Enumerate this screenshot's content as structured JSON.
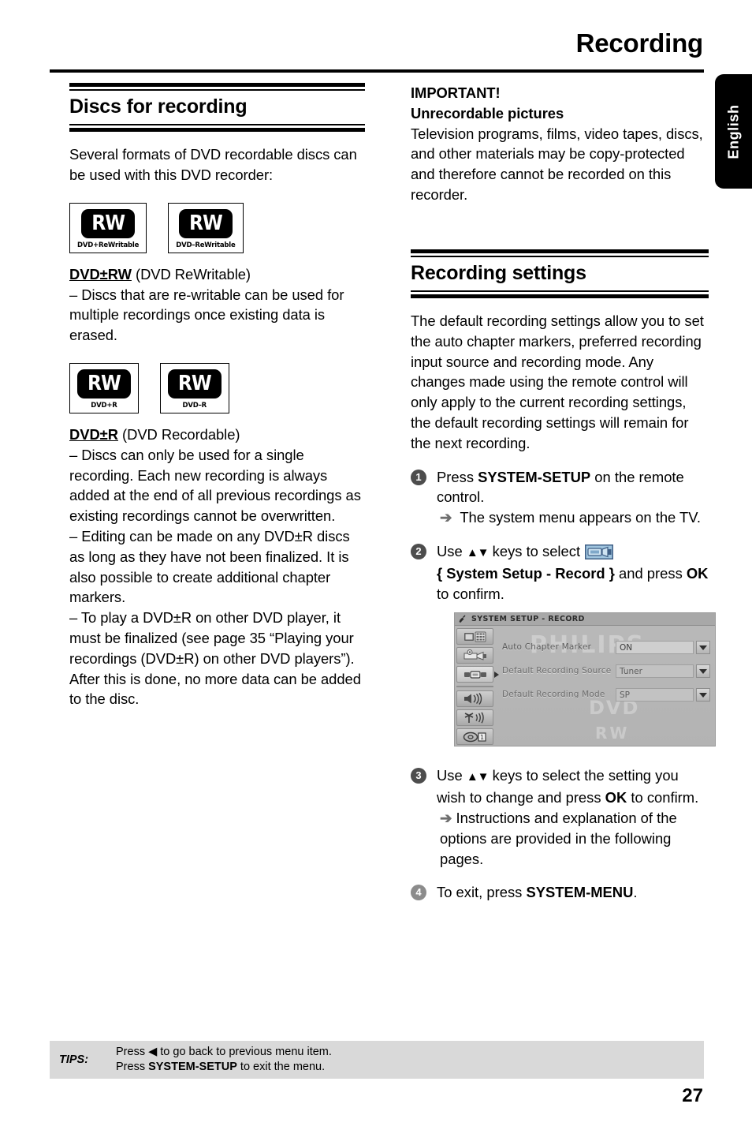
{
  "header": {
    "title": "Recording",
    "language_tab": "English"
  },
  "left_column": {
    "section_title": "Discs for recording",
    "intro": "Several formats of DVD recordable discs can be used with this DVD recorder:",
    "rw_logos": [
      {
        "mark": "RW",
        "caption": "DVD+ReWritable"
      },
      {
        "mark": "RW",
        "caption": "DVD–ReWritable"
      }
    ],
    "rw_heading_bold": "DVD±RW",
    "rw_heading_rest": " (DVD  ReWritable)",
    "rw_body": "–  Discs that are re-writable can be used for multiple recordings once existing data is erased.",
    "r_logos": [
      {
        "mark": "RW",
        "caption": "DVD+R"
      },
      {
        "mark": "RW",
        "caption": "DVD–R"
      }
    ],
    "r_heading_bold": "DVD±R",
    "r_heading_rest": " (DVD  Recordable)",
    "r_body_1": "–  Discs can only be used for a single recording. Each new recording is always added at the end of all previous recordings as existing recordings cannot be overwritten.",
    "r_body_2": "–  Editing can be made on any DVD±R discs as long as they have not been finalized. It is also possible to create additional chapter markers.",
    "r_body_3": "–  To play a DVD±R on other DVD player, it must be finalized (see page 35 “Playing your recordings (DVD±R) on other DVD players”). After this is done, no more data can be added to the disc."
  },
  "right_column": {
    "important_title": "IMPORTANT!",
    "important_subtitle": "Unrecordable pictures",
    "important_body": "Television programs, films, video tapes, discs, and other materials may be copy-protected and therefore cannot be recorded on this recorder.",
    "section_title": "Recording settings",
    "intro": "The default recording settings allow you to set the auto chapter markers, preferred recording input source and recording mode. Any changes made using the remote control will only apply to the current recording settings, the default recording settings will remain for the next recording.",
    "steps": [
      {
        "number": "1",
        "text_a": "Press ",
        "text_bold": "SYSTEM-SETUP",
        "text_b": " on the remote control.",
        "arrow_text": "The system menu appears on the TV."
      },
      {
        "number": "2",
        "text_a": "Use ",
        "keys": "▲▼",
        "text_b": " keys to select ",
        "icon": "camcorder-icon",
        "brace_open": "{ ",
        "menu_path": "System Setup - Record",
        "brace_close": " }",
        "text_c": " and press ",
        "ok": "OK",
        "text_d": " to confirm."
      },
      {
        "number": "3",
        "text_a": "Use ",
        "keys": "▲▼",
        "text_b": " keys to select the setting you wish to change and press ",
        "ok": "OK",
        "text_c": " to confirm.",
        "arrow_text": "Instructions and explanation of the options are provided in the following pages."
      },
      {
        "number": "4",
        "text_a": "To exit, press ",
        "text_bold": "SYSTEM-MENU",
        "text_b": "."
      }
    ]
  },
  "tv_menu": {
    "title": "SYSTEM SETUP - RECORD",
    "sidebar_icons": [
      "tv-playback-icon",
      "camera-recording-icon",
      "camcorder-record-icon",
      "speaker-audio-icon",
      "antenna-tuner-icon",
      "disc-features-icon"
    ],
    "selected_sidebar_index": 2,
    "rows": [
      {
        "label": "Auto Chapter Marker",
        "value": "ON",
        "active": true
      },
      {
        "label": "Default Recording Source",
        "value": "Tuner",
        "active": false
      },
      {
        "label": "Default Recording Mode",
        "value": "SP",
        "active": false
      }
    ],
    "watermarks": {
      "brand": "PHILIPS",
      "dvd": "DVD",
      "rw": "RW"
    }
  },
  "footer": {
    "tips_label": "TIPS:",
    "tips_line1_a": "Press ",
    "tips_line1_arrow": "◀",
    "tips_line1_b": " to go back to previous menu item.",
    "tips_line2_a": "Press ",
    "tips_line2_bold": "SYSTEM-SETUP",
    "tips_line2_b": " to exit the menu.",
    "page_number": "27"
  }
}
